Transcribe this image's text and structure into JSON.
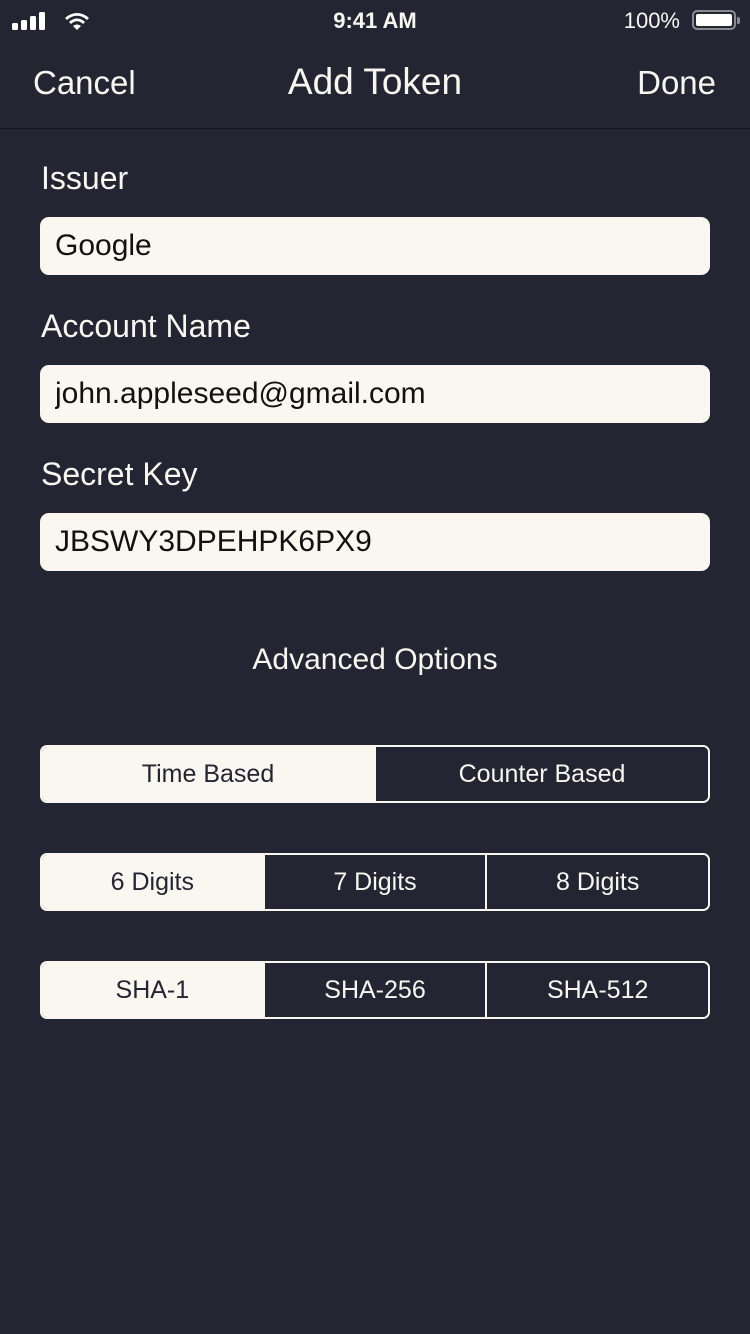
{
  "status_bar": {
    "time": "9:41 AM",
    "battery_percent": "100%",
    "battery_level": 1.0,
    "signal_bars": 4,
    "icons": [
      "signal-icon",
      "wifi-icon",
      "battery-icon"
    ]
  },
  "nav": {
    "cancel_label": "Cancel",
    "title": "Add Token",
    "done_label": "Done"
  },
  "form": {
    "issuer": {
      "label": "Issuer",
      "value": "Google"
    },
    "account_name": {
      "label": "Account Name",
      "value": "john.appleseed@gmail.com"
    },
    "secret_key": {
      "label": "Secret Key",
      "value": "JBSWY3DPEHPK6PX9"
    }
  },
  "advanced": {
    "title": "Advanced Options",
    "token_type": {
      "options": [
        "Time Based",
        "Counter Based"
      ],
      "selected": "Time Based"
    },
    "digits": {
      "options": [
        "6 Digits",
        "7 Digits",
        "8 Digits"
      ],
      "selected": "6 Digits"
    },
    "algorithm": {
      "options": [
        "SHA-1",
        "SHA-256",
        "SHA-512"
      ],
      "selected": "SHA-1"
    }
  },
  "colors": {
    "background": "#242533",
    "foreground": "#f8f6ef",
    "field_background": "#faf7f0"
  }
}
